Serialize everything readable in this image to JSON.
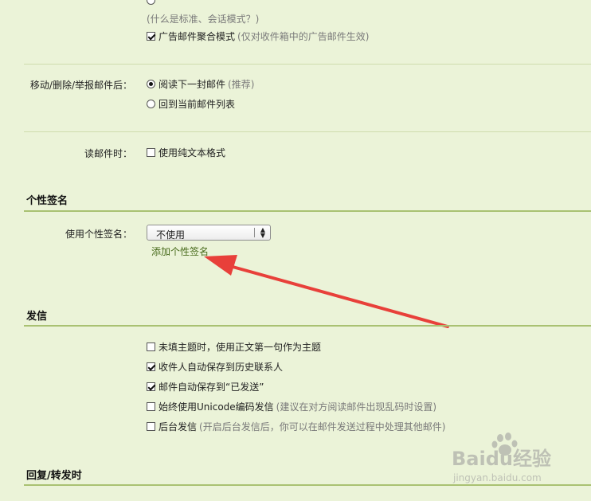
{
  "reading": {
    "top_hint": "(什么是标准、会话模式？)",
    "ad_aggregate": {
      "label": "广告邮件聚合模式",
      "hint": "(仅对收件箱中的广告邮件生效)",
      "checked": true
    }
  },
  "after_action": {
    "label": "移动/删除/举报邮件后：",
    "options": [
      {
        "label": "阅读下一封邮件",
        "hint": "(推荐)",
        "selected": true
      },
      {
        "label": "回到当前邮件列表",
        "hint": "",
        "selected": false
      }
    ]
  },
  "read_mail": {
    "label": "读邮件时：",
    "plain_text": {
      "label": "使用纯文本格式",
      "checked": false
    }
  },
  "signature": {
    "title": "个性签名",
    "label": "使用个性签名：",
    "select_value": "不使用",
    "add_link": "添加个性签名"
  },
  "send": {
    "title": "发信",
    "options": [
      {
        "label": "未填主题时，使用正文第一句作为主题",
        "hint": "",
        "checked": false
      },
      {
        "label": "收件人自动保存到历史联系人",
        "hint": "",
        "checked": true
      },
      {
        "label": "邮件自动保存到“已发送”",
        "hint": "",
        "checked": true
      },
      {
        "label": "始终使用Unicode编码发信",
        "hint": "(建议在对方阅读邮件出现乱码时设置)",
        "checked": false
      },
      {
        "label": "后台发信",
        "hint": "(开启后台发信后，你可以在邮件发送过程中处理其他邮件)",
        "checked": false
      }
    ]
  },
  "reply": {
    "title": "回复/转发时"
  },
  "watermark": {
    "brand": "Baidu经验",
    "url": "jingyan.baidu.com"
  },
  "colors": {
    "background": "#ebf3d8",
    "section_line": "#a9c172",
    "arrow": "#e8403a",
    "link": "#486b1c"
  }
}
